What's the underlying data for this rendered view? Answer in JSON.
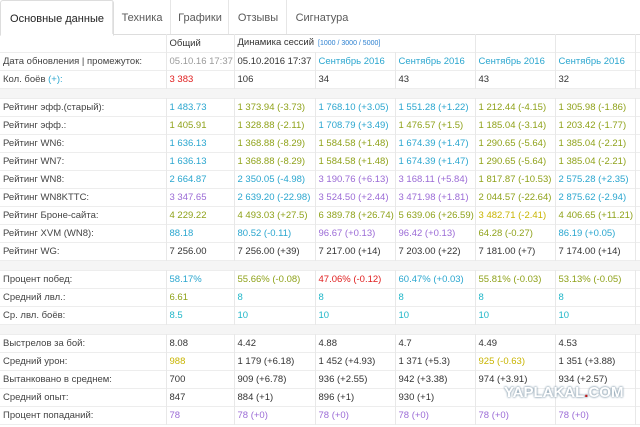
{
  "tabs": [
    "Основные данные",
    "Техника",
    "Графики",
    "Отзывы",
    "Сигнатура"
  ],
  "header": {
    "col_general": "Общий",
    "col_dynamics": "Динамика сессий",
    "dynamics_range": "[1000 / 3000 / 5000]"
  },
  "date_row": {
    "label": "Дата обновления | промежуток:",
    "values": [
      "05.10.16 17:37",
      "05.10.2016 17:37",
      "Сентябрь 2016",
      "Сентябрь 2016",
      "Сентябрь 2016",
      "Сентябрь 2016"
    ]
  },
  "battles_row": {
    "label": "Кол. боёв",
    "plus": "(+):",
    "values": [
      "3 383",
      "106",
      "34",
      "43",
      "43",
      "32"
    ]
  },
  "rating_rows": [
    {
      "label": "Рейтинг эфф.(старый):",
      "cells": [
        "1 483.73",
        "1 373.94 (-3.73)",
        "1 768.10 (+3.05)",
        "1 551.28 (+1.22)",
        "1 212.44 (-4.15)",
        "1 305.98 (-1.86)"
      ],
      "colors": [
        "blue",
        "olive",
        "blue",
        "blue",
        "olive",
        "olive"
      ]
    },
    {
      "label": "Рейтинг эфф.:",
      "cells": [
        "1 405.91",
        "1 328.88 (-2.11)",
        "1 708.79 (+3.49)",
        "1 476.57 (+1.5)",
        "1 185.04 (-3.14)",
        "1 203.42 (-1.77)"
      ],
      "colors": [
        "olive",
        "olive",
        "blue",
        "olive",
        "olive",
        "olive"
      ]
    },
    {
      "label": "Рейтинг WN6:",
      "cells": [
        "1 636.13",
        "1 368.88 (-8.29)",
        "1 584.58 (+1.48)",
        "1 674.39 (+1.47)",
        "1 290.65 (-5.64)",
        "1 385.04 (-2.21)"
      ],
      "colors": [
        "blue",
        "olive",
        "olive",
        "blue",
        "olive",
        "olive"
      ]
    },
    {
      "label": "Рейтинг WN7:",
      "cells": [
        "1 636.13",
        "1 368.88 (-8.29)",
        "1 584.58 (+1.48)",
        "1 674.39 (+1.47)",
        "1 290.65 (-5.64)",
        "1 385.04 (-2.21)"
      ],
      "colors": [
        "blue",
        "olive",
        "olive",
        "blue",
        "olive",
        "olive"
      ]
    },
    {
      "label": "Рейтинг WN8:",
      "cells": [
        "2 664.87",
        "2 350.05 (-4.98)",
        "3 190.76 (+6.13)",
        "3 168.11 (+5.84)",
        "1 817.87 (-10.53)",
        "2 575.28 (+2.35)"
      ],
      "colors": [
        "blue",
        "blue",
        "purple",
        "purple",
        "olive",
        "blue"
      ]
    },
    {
      "label": "Рейтинг WN8KTTC:",
      "cells": [
        "3 347.65",
        "2 639.20 (-22.98)",
        "3 524.50 (+2.44)",
        "3 471.98 (+1.81)",
        "2 044.57 (-22.64)",
        "2 875.62 (-2.94)"
      ],
      "colors": [
        "purple",
        "blue",
        "purple",
        "purple",
        "olive",
        "blue"
      ]
    },
    {
      "label": "Рейтинг Броне-сайта:",
      "cells": [
        "4 229.22",
        "4 493.03 (+27.5)",
        "6 389.78 (+26.74)",
        "5 639.06 (+26.59)",
        "3 482.71 (-2.41)",
        "4 406.65 (+11.21)"
      ],
      "colors": [
        "olive",
        "olive",
        "olive",
        "olive",
        "yellow",
        "olive"
      ]
    },
    {
      "label": "Рейтинг XVM (WN8):",
      "cells": [
        "88.18",
        "80.52 (-0.11)",
        "96.67 (+0.13)",
        "96.42 (+0.13)",
        "64.28 (-0.27)",
        "86.19 (+0.05)"
      ],
      "colors": [
        "blue",
        "blue",
        "purple",
        "purple",
        "olive",
        "blue"
      ]
    },
    {
      "label": "Рейтинг WG:",
      "cells": [
        "7 256.00",
        "7 256.00 (+39)",
        "7 217.00 (+14)",
        "7 203.00 (+22)",
        "7 181.00 (+7)",
        "7 174.00 (+14)"
      ],
      "colors": [
        "dark",
        "dark",
        "dark",
        "dark",
        "dark",
        "dark"
      ]
    }
  ],
  "win_rows": [
    {
      "label": "Процент побед:",
      "cells": [
        "58.17%",
        "55.66% (-0.08)",
        "47.06% (-0.12)",
        "60.47% (+0.03)",
        "55.81% (-0.03)",
        "53.13% (-0.05)"
      ],
      "colors": [
        "blue",
        "olive",
        "red",
        "blue",
        "olive",
        "olive"
      ]
    },
    {
      "label": "Средний лвл.:",
      "cells": [
        "6.61",
        "8",
        "8",
        "8",
        "8",
        "8"
      ],
      "colors": [
        "olive",
        "cyan",
        "cyan",
        "cyan",
        "cyan",
        "cyan"
      ]
    },
    {
      "label": "Ср. лвл. боёв:",
      "cells": [
        "8.5",
        "10",
        "10",
        "10",
        "10",
        "10"
      ],
      "colors": [
        "cyan",
        "cyan",
        "cyan",
        "cyan",
        "cyan",
        "cyan"
      ]
    }
  ],
  "stat_rows": [
    {
      "label": "Выстрелов за бой:",
      "cells": [
        "8.08",
        "4.42",
        "4.88",
        "4.7",
        "4.49",
        "4.53"
      ],
      "colors": [
        "dark",
        "dark",
        "dark",
        "dark",
        "dark",
        "dark"
      ]
    },
    {
      "label": "Средний урон:",
      "cells": [
        "988",
        "1 179 (+6.18)",
        "1 452 (+4.93)",
        "1 371 (+5.3)",
        "925 (-0.63)",
        "1 351 (+3.88)"
      ],
      "colors": [
        "yellow",
        "dark",
        "dark",
        "dark",
        "yellow",
        "dark"
      ]
    },
    {
      "label": "Вытанковано в среднем:",
      "cells": [
        "700",
        "909 (+6.78)",
        "936 (+2.55)",
        "942 (+3.38)",
        "974 (+3.91)",
        "934 (+2.57)"
      ],
      "colors": [
        "dark",
        "dark",
        "dark",
        "dark",
        "dark",
        "dark"
      ]
    },
    {
      "label": "Средний опыт:",
      "cells": [
        "847",
        "884 (+1)",
        "896 (+1)",
        "930 (+1)",
        "",
        ""
      ],
      "colors": [
        "dark",
        "dark",
        "dark",
        "dark",
        "dark",
        "dark"
      ]
    },
    {
      "label": "Процент попаданий:",
      "cells": [
        "78",
        "78 (+0)",
        "78 (+0)",
        "78 (+0)",
        "78 (+0)",
        "78 (+0)"
      ],
      "colors": [
        "purple",
        "purple",
        "purple",
        "purple",
        "purple",
        "purple"
      ]
    }
  ],
  "watermark": {
    "left": "YAPLAKAL",
    "dot": ".",
    "right": "COM"
  },
  "colors": {
    "blue": "#2aa6cf",
    "olive": "#8fa21a",
    "purple": "#9b6bd6",
    "yellow": "#c8b400",
    "red": "#e02020",
    "cyan": "#1fb6c8"
  }
}
